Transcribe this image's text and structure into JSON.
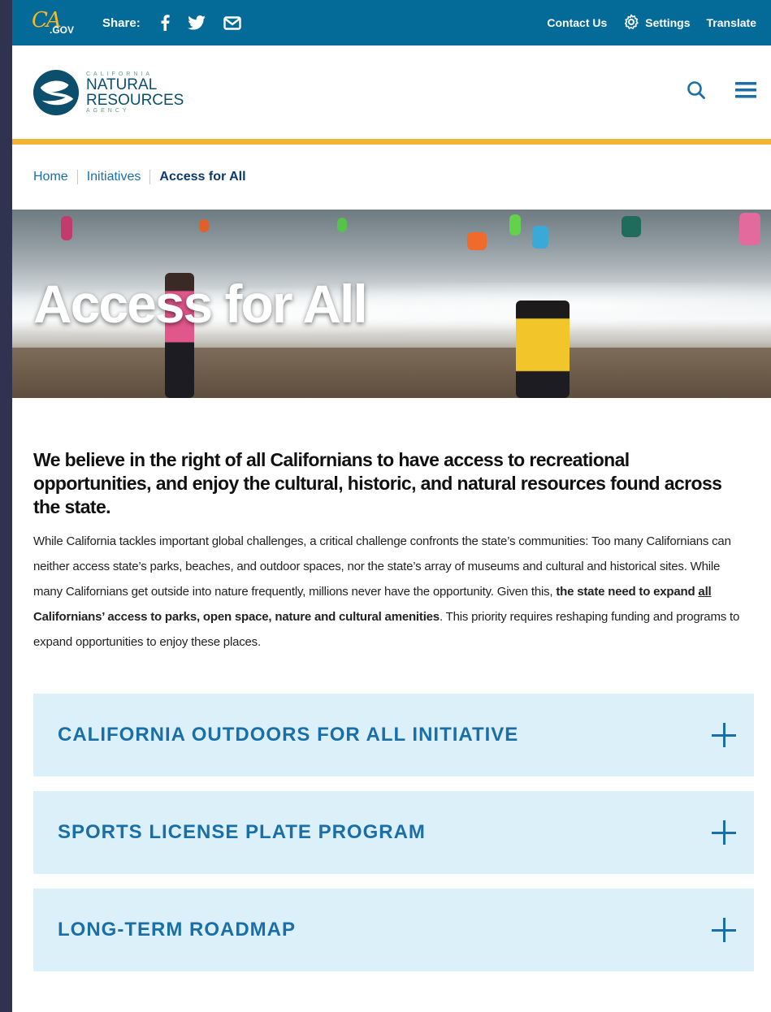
{
  "utility_bar": {
    "ca_logo_text": "CA",
    "ca_logo_gov": ".GOV",
    "share_label": "Share:",
    "contact_label": "Contact Us",
    "settings_label": "Settings",
    "translate_label": "Translate",
    "color": "#046b99"
  },
  "brand": {
    "agency_top": "CALIFORNIA",
    "agency_line1": "NATURAL",
    "agency_line2": "RESOURCES",
    "agency_bottom": "AGENCY",
    "accent_color": "#f2b632"
  },
  "breadcrumb": {
    "items": [
      "Home",
      "Initiatives"
    ],
    "current": "Access for All"
  },
  "hero": {
    "title": "Access for All"
  },
  "content": {
    "lead": "We believe in the right of all Californians to have access to recreational opportunities, and enjoy the cultural, historic, and natural resources found across the state.",
    "body_part1": "While California tackles important global challenges, a critical challenge confronts the state’s communities: Too many Californians can neither access state’s parks, beaches, and outdoor spaces, nor the state’s array of museums and cultural and historical sites. While many Californians get outside into nature frequently, millions never have the opportunity. Given this, ",
    "body_bold_a": "the state need to expand ",
    "body_bold_underline": "all",
    "body_bold_b": " Californians’ access to parks, open space, nature and cultural amenities",
    "body_part2": ". This priority requires reshaping funding and programs to expand opportunities to enjoy these places."
  },
  "accordion": {
    "items": [
      {
        "title": "CALIFORNIA OUTDOORS FOR ALL INITIATIVE"
      },
      {
        "title": "SPORTS LICENSE PLATE PROGRAM"
      },
      {
        "title": "LONG-TERM ROADMAP"
      }
    ],
    "bg_color": "#dcf0f9",
    "text_color": "#1a6fa8"
  }
}
